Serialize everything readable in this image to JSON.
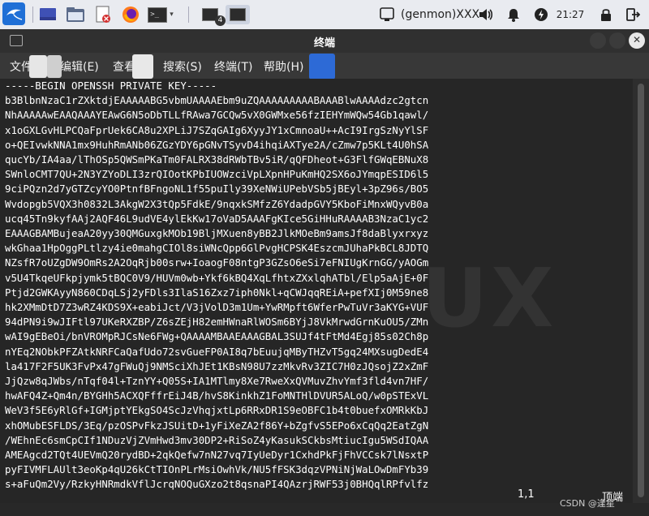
{
  "panel": {
    "genmon": "(genmon)XXX",
    "clock": "21:27",
    "task_badge": "4",
    "prompt_glyph": ">_"
  },
  "window": {
    "title": "终端"
  },
  "menu": [
    "文件(F)",
    "编辑(E)",
    "查看(V)",
    "搜索(S)",
    "终端(T)",
    "帮助(H)"
  ],
  "terminal": {
    "lines": [
      "-----BEGIN OPENSSH PRIVATE KEY-----",
      "b3BlbnNzaC1rZXktdjEAAAAABG5vbmUAAAAEbm9uZQAAAAAAAAABAAABlwAAAAdzc2gtcn",
      "NhAAAAAwEAAQAAAYEAwG6N5oDbTLLfRAwa7GCQw5vX0GWMxe56fzIEHYmWQw54Gb1qawl/",
      "x1oGXLGvHLPCQaFprUek6CA8u2XPLiJ7SZqGAIg6XyyJY1xCmnoaU++AcI9IrgSzNyYlSF",
      "o+QEIvwkNNA1mx9HuhRmANb06ZGzYDY6pGNvTSyvD4ihqiAXTye2A/cZmw7p5KLt4U0hSA",
      "qucYb/IA4aa/lThOSp5QWSmPKaTm0FALRX38dRWbTBv5iR/qQFDheot+G3FlfGWqEBNuX8",
      "SWnloCMT7QU+2N3YZYoDLI3zrQIOotKPbIUOWzciVpLXpnHPuKmHQ2SX6oJYmqpESID6l5",
      "9ciPQzn2d7yGTZcyYO0PtnfBFngoNL1f55puIly39XeNWiUPebVSb5jBEyl+3pZ96s/BO5",
      "Wvdopgb5VQX3h0832L3AkgW2X3tQp5FdkE/9nqxkSMfzZ6YdadpGVY5KboFiMnxWQyvB0a",
      "ucq45Tn9kyfAAj2AQF46L9udVE4ylEkKw17oVaD5AAAFgKIce5GiHHuRAAAAB3NzaC1yc2",
      "EAAAGBAMBujeaA20yy30QMGuxgkMOb19BljMXuen8yBB2JlkMOeBm9amsJf8daBlyxrxyz",
      "wkGhaa1HpOggPLtlzy4ie0mahgCIOl8siWNcQpp6GlPvgHCPSK4EszcmJUhaPkBCL8JDTQ",
      "NZsfR7oUZgDW9OmRs2A2OqRjb00srw+IoaogF08ntgP3GZsO6eSi7eFNIUgKrnGG/yAOGm",
      "v5U4TkqeUFkpjymk5tBQC0V9/HUVm0wb+Ykf6kBQ4XqLfhtxZXxlqhATbl/Elp5aAjE+0F",
      "Ptjd2GWKAyyN860CDqLSj2yFDls3IlaS16Zxz7iph0Nkl+qCWJqqREiA+pefXIj0M59ne8",
      "hk2XMmDtD7Z3wRZ4KDS9X+eabiJct/V3jVolD3m1Um+YwRMpft6WferPwTuVr3aKYG+VUF",
      "94dPN9i9wJIFtl97UKeRXZBP/Z6sZEjH82emHWnaRlWOSm6BYjJ8VkMrwdGrnKuOU5/ZMn",
      "wAI9gEBeOi/bnVROMpRJCsNe6FWg+QAAAAMBAAEAAAGBAL3SUJf4tFtMd4Egj85s02Ch8p",
      "nYEq2NObkPFZAtkNRFCaQafUdo72svGueFP0AI8q7bEuujqMByTHZvT5gq24MXsugDedE4",
      "la417F2F5UK3FvPx47gFWuQj9NMSciXhJEt1KBsN98U7zzMkvRv3ZIC7H0zJQsojZ2xZmF",
      "JjQzw8qJWbs/nTqf04l+TznYY+Q05S+IA1MTlmy8Xe7RweXxQVMuvZhvYmf3fld4vn7HF/",
      "hwAFQ4Z+Qm4n/BYGHh5ACXQFffrEiJ4B/hvS8KinkhZ1FoMNTHlDVUR5ALoQ/w0pSTExVL",
      "WeV3f5E6yRlGf+IGMjptYEkgSO4ScJzVhqjxtLp6RRxDR1S9eOBFC1b4t0buefxOMRkKbJ",
      "xhOMubESFLDS/3Eq/pzOSPvFkzJSUitD+1yFiXeZA2f86Y+bZgfvS5EPo6xCqQq2EatZgN",
      "/WEhnEc6smCpCIf1NDuzVjZVmHwd3mv30DP2+RiSoZ4yKasukSCkbsMtiucIgu5WSdIQAA",
      "AMEAgcd2TQt4UEVmQ20rydBD+2qkQefw7nN27vq7IyUeDyr1CxhdPkFjFhVCCsk7lNsxtP",
      "pyFIVMFLAUlt3eoKp4qU26kCtTIOnPLrMsiOwhVk/NU5fFSK3dqzVPNiNjWaLOwDmFYb39",
      "s+aFuQm2Vy/RzkyHNRmdkVflJcrqNOQuGXzo2t8qsnaPI4QAzrjRWF53j0BHQqlRPfvlfz"
    ],
    "cursor_position": "1,1",
    "scroll_position": "顶端"
  },
  "watermark": "CSDN @逢星",
  "colors": {
    "terminal_bg": "#262626",
    "menubar_bg": "#383838",
    "titlebar_bg": "#303030",
    "panel_bg": "#e9ebf0",
    "kali_blue": "#1f6fd6",
    "firefox_orange": "#ff7a1a"
  }
}
